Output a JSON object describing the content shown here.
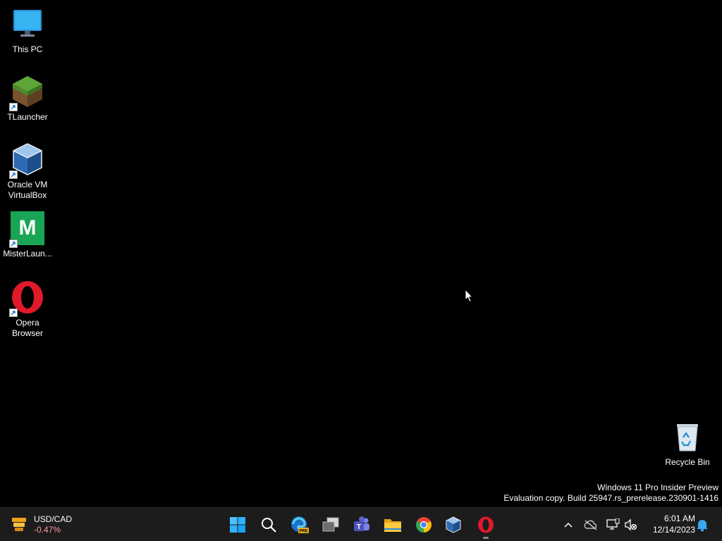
{
  "desktop": {
    "icons": [
      {
        "label": "This PC"
      },
      {
        "label": "TLauncher"
      },
      {
        "label": "Oracle VM\nVirtualBox"
      },
      {
        "label": "MisterLaun..."
      },
      {
        "label": "Opera\nBrowser"
      },
      {
        "label": "Recycle Bin"
      }
    ],
    "misterlauncher_glyph": "M",
    "watermark": {
      "line1": "Windows 11 Pro Insider Preview",
      "line2": "Evaluation copy. Build 25947.rs_prerelease.230901-1416"
    }
  },
  "taskbar": {
    "widget": {
      "symbol": "USD/CAD",
      "change": "-0.47%",
      "change_color": "#ff99a4"
    },
    "apps": [
      {
        "icon": "start-icon"
      },
      {
        "icon": "search-icon"
      },
      {
        "icon": "edge-preview-icon",
        "badge": "PRE"
      },
      {
        "icon": "task-view-icon"
      },
      {
        "icon": "teams-icon"
      },
      {
        "icon": "file-explorer-icon"
      },
      {
        "icon": "chrome-icon"
      },
      {
        "icon": "virtualbox-icon"
      },
      {
        "icon": "opera-icon",
        "running": true
      }
    ],
    "tray": {
      "time": "6:01 AM",
      "date": "12/14/2023"
    }
  },
  "colors": {
    "accent": "#0078d4",
    "desktop_bg": "#000000",
    "taskbar_bg": "#1c1c1c"
  }
}
